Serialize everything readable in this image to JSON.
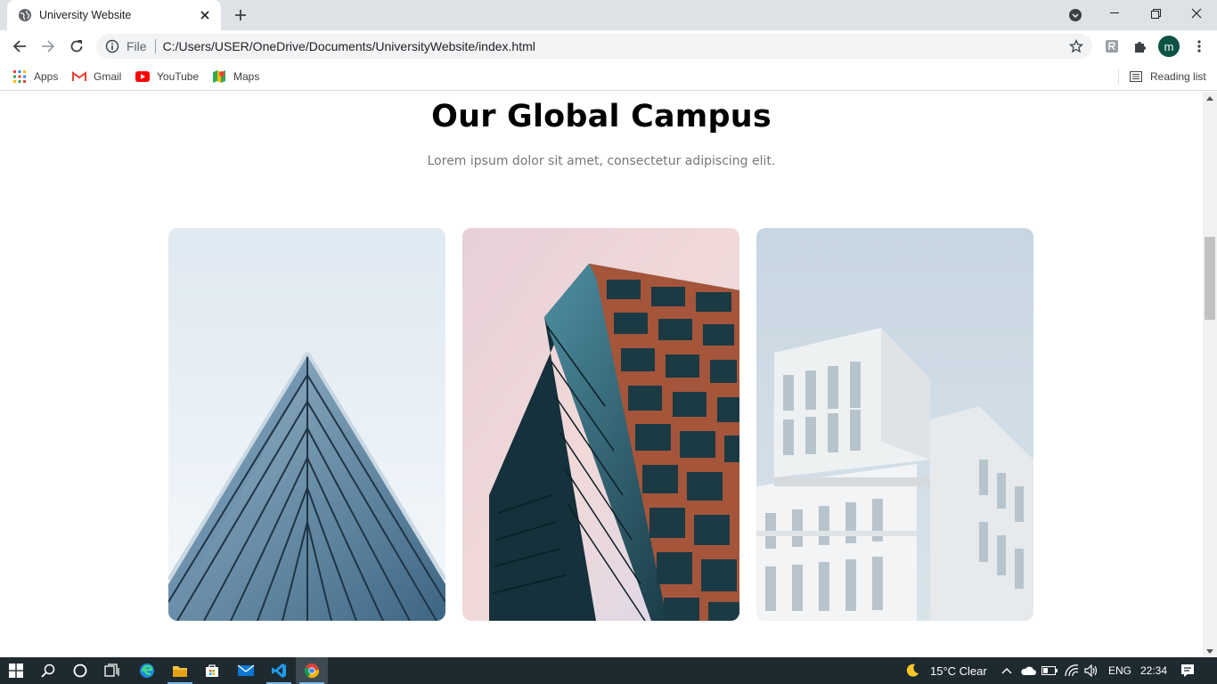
{
  "browser": {
    "tab_title": "University Website",
    "url_scheme": "File",
    "url": "C:/Users/USER/OneDrive/Documents/UniversityWebsite/index.html",
    "profile_initial": "m",
    "bookmarks": [
      "Apps",
      "Gmail",
      "YouTube",
      "Maps"
    ],
    "reading_list": "Reading list"
  },
  "page": {
    "title": "Our Global Campus",
    "subtitle": "Lorem ipsum dolor sit amet, consectetur adipiscing elit.",
    "campus_cards": [
      {
        "image": "glass-triangle-building"
      },
      {
        "image": "copper-glass-tower"
      },
      {
        "image": "white-modern-building"
      }
    ],
    "scroll_position": 0.29
  },
  "taskbar": {
    "apps": [
      "start",
      "search",
      "cortana",
      "task-view",
      "edge",
      "file-explorer",
      "store",
      "mail",
      "vscode",
      "chrome"
    ],
    "weather": "15°C  Clear",
    "language": "ENG",
    "time": "22:34"
  },
  "colors": {
    "chrome_frame": "#dee1e6",
    "profile": "#0b5345",
    "taskbar": "#1f2a30"
  }
}
